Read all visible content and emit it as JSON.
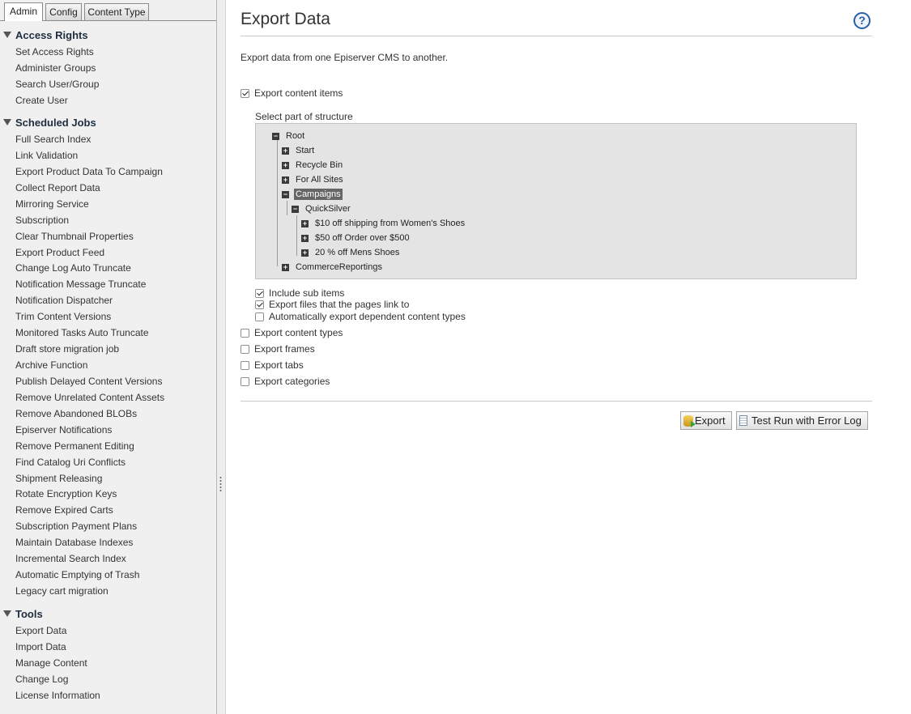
{
  "left_tabs": [
    "Admin",
    "Config",
    "Content Type"
  ],
  "sections": [
    {
      "title": "Access Rights",
      "items": [
        "Set Access Rights",
        "Administer Groups",
        "Search User/Group",
        "Create User"
      ]
    },
    {
      "title": "Scheduled Jobs",
      "items": [
        "Full Search Index",
        "Link Validation",
        "Export Product Data To Campaign",
        "Collect Report Data",
        "Mirroring Service",
        "Subscription",
        "Clear Thumbnail Properties",
        "Export Product Feed",
        "Change Log Auto Truncate",
        "Notification Message Truncate",
        "Notification Dispatcher",
        "Trim Content Versions",
        "Monitored Tasks Auto Truncate",
        "Draft store migration job",
        "Archive Function",
        "Publish Delayed Content Versions",
        "Remove Unrelated Content Assets",
        "Remove Abandoned BLOBs",
        "Episerver Notifications",
        "Remove Permanent Editing",
        "Find Catalog Uri Conflicts",
        "Shipment Releasing",
        "Rotate Encryption Keys",
        "Remove Expired Carts",
        "Subscription Payment Plans",
        "Maintain Database Indexes",
        "Incremental Search Index",
        "Automatic Emptying of Trash",
        "Legacy cart migration"
      ]
    },
    {
      "title": "Tools",
      "items": [
        "Export Data",
        "Import Data",
        "Manage Content",
        "Change Log",
        "License Information"
      ]
    }
  ],
  "main": {
    "title": "Export Data",
    "help": "?",
    "description": "Export data from one Episerver CMS to another.",
    "export_content_items": {
      "label": "Export content items",
      "checked": true
    },
    "select_label": "Select part of structure",
    "tree": [
      {
        "label": "Root",
        "toggle": "−"
      },
      {
        "label": "Start",
        "toggle": "+"
      },
      {
        "label": "Recycle Bin",
        "toggle": "+"
      },
      {
        "label": "For All Sites",
        "toggle": "+"
      },
      {
        "label": "Campaigns",
        "toggle": "−"
      },
      {
        "label": "QuickSilver",
        "toggle": "−"
      },
      {
        "label": "$10 off shipping from Women's Shoes",
        "toggle": "+"
      },
      {
        "label": "$50 off Order over $500",
        "toggle": "+"
      },
      {
        "label": "20 % off Mens Shoes",
        "toggle": "+"
      },
      {
        "label": "CommerceReportings",
        "toggle": "+"
      }
    ],
    "sub_options": [
      {
        "label": "Include sub items",
        "checked": true
      },
      {
        "label": "Export files that the pages link to",
        "checked": true
      },
      {
        "label": "Automatically export dependent content types",
        "checked": false
      }
    ],
    "options": [
      {
        "label": "Export content types",
        "checked": false
      },
      {
        "label": "Export frames",
        "checked": false
      },
      {
        "label": "Export tabs",
        "checked": false
      },
      {
        "label": "Export categories",
        "checked": false
      }
    ],
    "buttons": {
      "export": "Export",
      "test_run": "Test Run with Error Log"
    }
  }
}
